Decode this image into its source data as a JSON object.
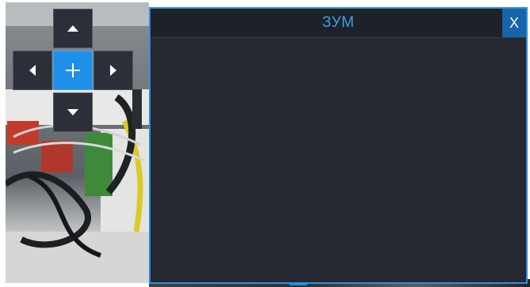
{
  "zoom_window": {
    "title": "ЗУМ",
    "close_label": "X"
  },
  "ptz": {
    "up_icon": "chevron-up-icon",
    "down_icon": "chevron-down-icon",
    "left_icon": "chevron-left-icon",
    "right_icon": "chevron-right-icon",
    "center_icon": "plus-icon"
  },
  "colors": {
    "accent": "#1e90ea",
    "window_bg": "#262831",
    "title_text": "#3aa0ee",
    "close_bg": "#1565a8"
  }
}
